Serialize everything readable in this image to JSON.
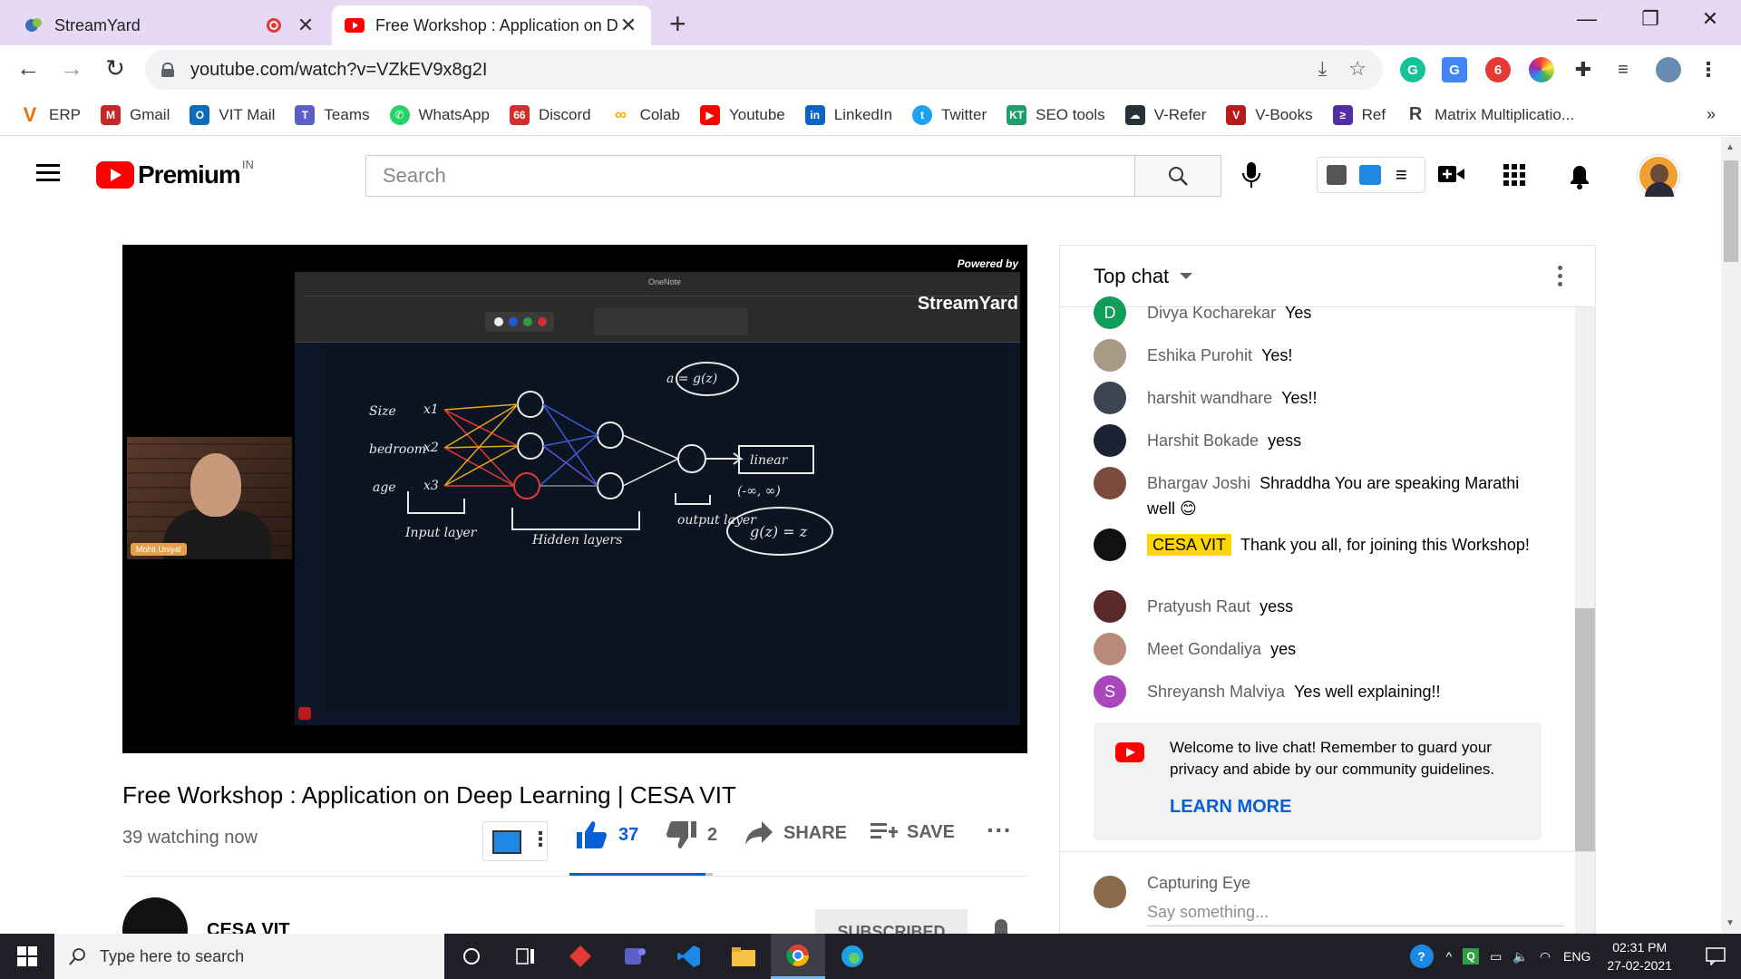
{
  "browser": {
    "tabs": [
      {
        "title": "StreamYard",
        "active": false
      },
      {
        "title": "Free Workshop : Application on D",
        "active": true
      }
    ],
    "new_tab": "+",
    "url": "youtube.com/watch?v=VZkEV9x8g2I",
    "bookmarks": [
      "ERP",
      "Gmail",
      "VIT Mail",
      "Teams",
      "WhatsApp",
      "Discord",
      "Colab",
      "Youtube",
      "LinkedIn",
      "Twitter",
      "SEO tools",
      "V-Refer",
      "V-Books",
      "Ref",
      "Matrix Multiplicatio..."
    ],
    "bookmarks_more": "»"
  },
  "youtube": {
    "logo_word": "Premium",
    "country_code": "IN",
    "search_placeholder": "Search"
  },
  "video": {
    "powered_by": "Powered by",
    "streamyard_label": "StreamYard",
    "presenter_name": "Mohit Uniyal",
    "onenote_title": "OneNote",
    "title": "Free Workshop : Application on Deep Learning | CESA VIT",
    "watching": "39 watching now",
    "likes": "37",
    "dislikes": "2",
    "like_ratio": 0.95,
    "share_label": "SHARE",
    "save_label": "SAVE",
    "channel_name": "CESA VIT",
    "subscribe_label": "SUBSCRIBED",
    "board": {
      "a_eq": "a = g(z)",
      "size": "Size",
      "bedroom": "bedroom",
      "age": "age",
      "x1": "x1",
      "x2": "x2",
      "x3": "x3",
      "input_layer": "Input layer",
      "hidden_layers": "Hidden layers",
      "output_layer": "output layer",
      "linear": "linear",
      "range": "(-∞, ∞)",
      "gz": "g(z) = z"
    }
  },
  "chat": {
    "mode": "Top chat",
    "messages": [
      {
        "author": "Divya Kocharekar",
        "text": "Yes",
        "initial": "D",
        "color": "#0f9d58"
      },
      {
        "author": "Eshika Purohit",
        "text": "Yes!",
        "initial": "",
        "color": "#a89886"
      },
      {
        "author": "harshit wandhare",
        "text": "Yes!!",
        "initial": "",
        "color": "#3a4452"
      },
      {
        "author": "Harshit Bokade",
        "text": "yess",
        "initial": "",
        "color": "#1b2233"
      },
      {
        "author": "Bhargav Joshi",
        "text": "Shraddha You are speaking Marathi well 😊",
        "initial": "",
        "color": "#7a4a3a"
      },
      {
        "author": "CESA VIT",
        "text": "Thank you all, for joining this Workshop!",
        "initial": "",
        "color": "#111111",
        "is_owner": true
      },
      {
        "author": "Pratyush Raut",
        "text": "yess",
        "initial": "",
        "color": "#5a2a2a"
      },
      {
        "author": "Meet Gondaliya",
        "text": "yes",
        "initial": "",
        "color": "#b88a7a"
      },
      {
        "author": "Shreyansh Malviya",
        "text": "Yes well explaining!!",
        "initial": "S",
        "color": "#ab47bc"
      }
    ],
    "welcome_text": "Welcome to live chat! Remember to guard your privacy and abide by our community guidelines.",
    "learn_more": "LEARN MORE",
    "current_user": "Capturing Eye",
    "input_placeholder": "Say something..."
  },
  "taskbar": {
    "search_placeholder": "Type here to search",
    "language": "ENG",
    "time": "02:31 PM",
    "date": "27-02-2021"
  }
}
